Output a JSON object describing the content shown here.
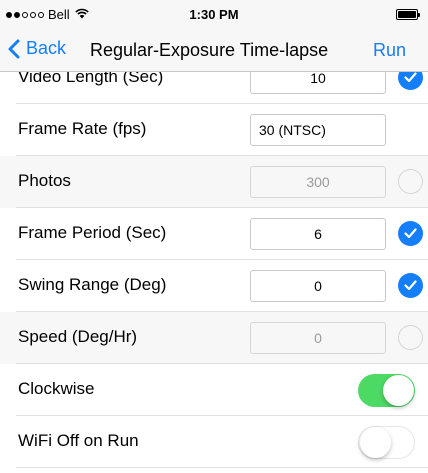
{
  "status_bar": {
    "signal_dots": [
      true,
      true,
      false,
      false,
      false
    ],
    "carrier": "Bell",
    "wifi_icon": "wifi-icon",
    "time": "1:30 PM",
    "battery_level": 1.0
  },
  "nav": {
    "back_label": "Back",
    "title": "Regular-Exposure Time-lapse",
    "run_label": "Run"
  },
  "rows": [
    {
      "label": "Video Length (Sec)",
      "value": "10",
      "enabled": true,
      "checked": true
    },
    {
      "label": "Frame Rate (fps)",
      "value": "30 (NTSC)",
      "enabled": true,
      "checked": null
    },
    {
      "label": "Photos",
      "value": "300",
      "enabled": false,
      "checked": false
    },
    {
      "label": "Frame Period (Sec)",
      "value": "6",
      "enabled": true,
      "checked": true
    },
    {
      "label": "Swing Range (Deg)",
      "value": "0",
      "enabled": true,
      "checked": true
    },
    {
      "label": "Speed (Deg/Hr)",
      "value": "0",
      "enabled": false,
      "checked": false
    }
  ],
  "toggles": [
    {
      "label": "Clockwise",
      "on": true
    },
    {
      "label": "WiFi Off on Run",
      "on": false
    }
  ],
  "colors": {
    "accent": "#157efb",
    "toggle_on": "#4cd964"
  }
}
